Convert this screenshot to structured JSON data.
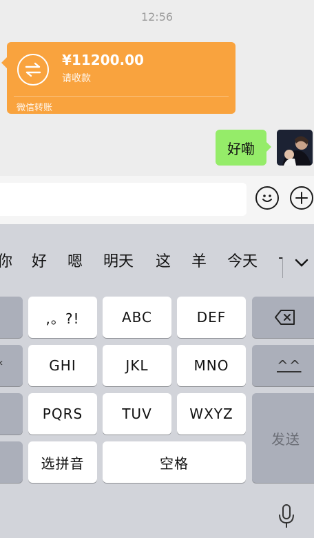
{
  "chat": {
    "timestamp": "12:56",
    "transfer": {
      "amount": "¥11200.00",
      "subtitle": "请收款",
      "footer": "微信转账"
    },
    "my_message": "好嘞"
  },
  "input_bar": {
    "text": ""
  },
  "keyboard": {
    "candidates": [
      "你",
      "好",
      "嗯",
      "明天",
      "这",
      "羊",
      "今天",
      "-"
    ],
    "keys": {
      "punct": ",。?!",
      "abc": "ABC",
      "def": "DEF",
      "ghi": "GHI",
      "jkl": "JKL",
      "mno": "MNO",
      "pqrs": "PQRS",
      "tuv": "TUV",
      "wxyz": "WXYZ",
      "select_pinyin": "选拼音",
      "space": "空格",
      "send": "发送",
      "emoticon": "^^",
      "left_partial_2": "*"
    }
  },
  "colors": {
    "transfer_bg": "#f9a33e",
    "my_bubble_bg": "#95ec69",
    "keyboard_bg": "#d2d4da",
    "key_dark": "#abafba"
  }
}
